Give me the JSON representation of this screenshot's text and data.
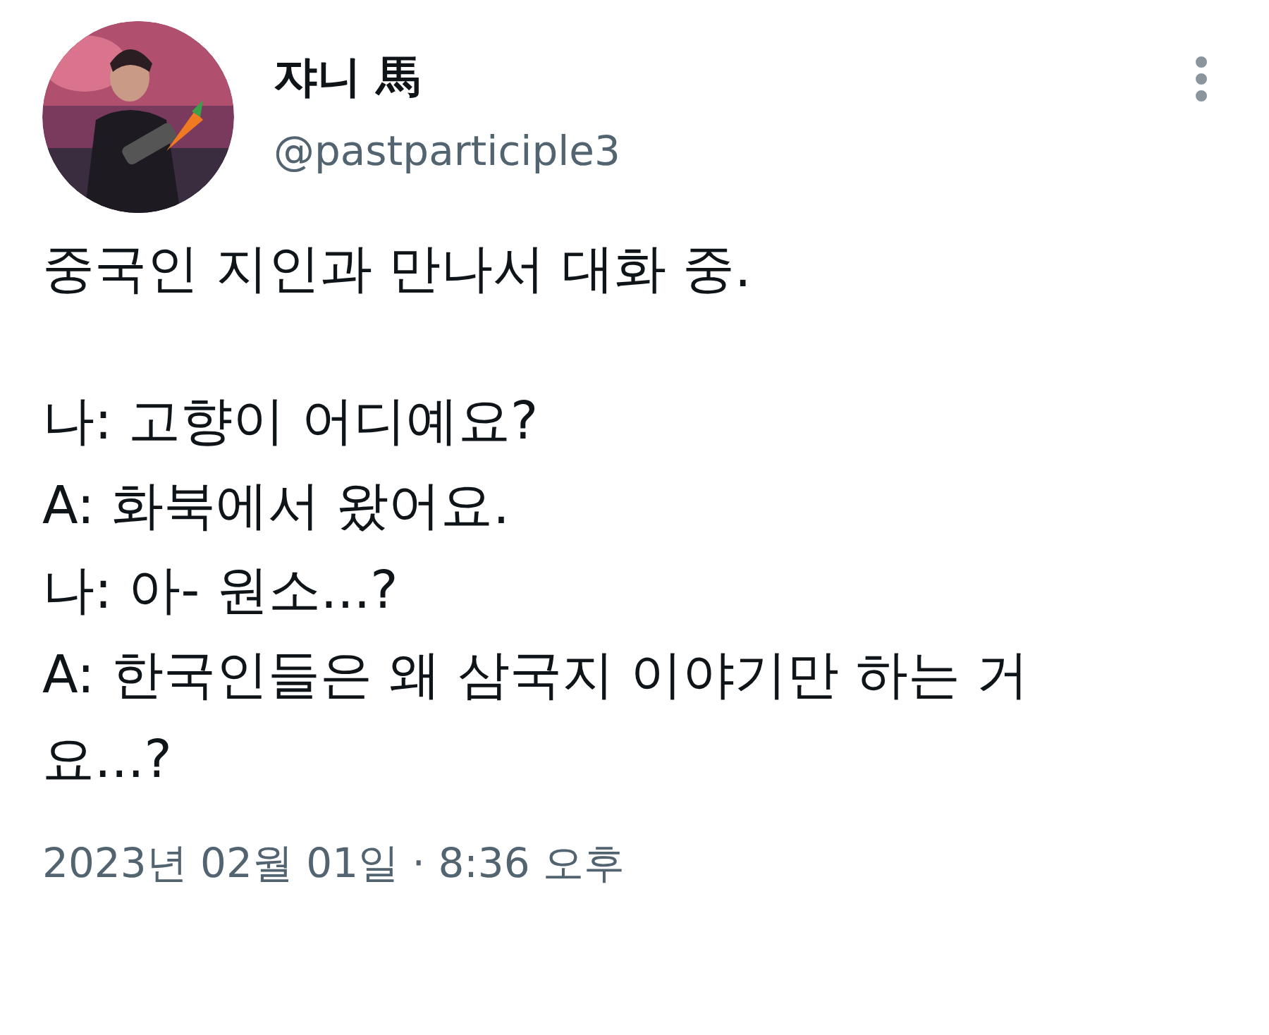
{
  "author": {
    "name": "쟈니 馬",
    "handle": "@pastparticiple3"
  },
  "tweet": {
    "paragraphs": [
      [
        "중국인 지인과 만나서 대화 중."
      ],
      [
        "나: 고향이 어디예요?",
        "A: 화북에서 왔어요.",
        "나: 아- 원소...?",
        "A: 한국인들은 왜 삼국지 이야기만 하는 거요...?"
      ]
    ],
    "timestamp": "2023년 02월 01일 · 8:36 오후"
  }
}
